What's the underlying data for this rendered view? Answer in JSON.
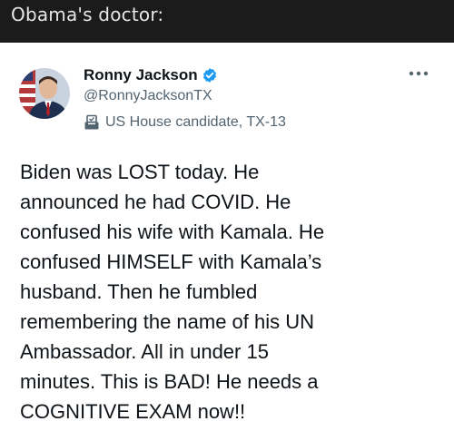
{
  "caption": "Obama's doctor:",
  "tweet": {
    "author_name": "Ronny Jackson",
    "handle": "@RonnyJacksonTX",
    "candidate_label": "US House candidate, TX-13",
    "text_lines": [
      "Biden was LOST today. He",
      "announced he had COVID. He",
      "confused his wife with Kamala. He",
      "confused HIMSELF with Kamala’s",
      "husband. Then he fumbled",
      "remembering the name of his UN",
      "Ambassador. All in under 15",
      "minutes. This is BAD! He needs a",
      "COGNITIVE EXAM now!!"
    ]
  },
  "colors": {
    "caption_bg": "#1b1b1b",
    "verified_blue": "#1d9bf0",
    "secondary_text": "#536471",
    "primary_text": "#0f1419"
  },
  "icons": {
    "verified": "verified-badge-icon",
    "candidate": "ballot-box-icon",
    "more": "more-options-icon"
  }
}
